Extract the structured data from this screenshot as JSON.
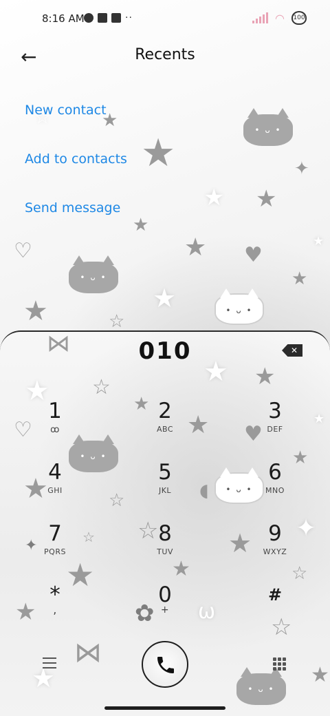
{
  "status_bar": {
    "time": "8:16 AM",
    "battery": "100",
    "icons": [
      "signal-icon",
      "wifi-icon",
      "battery-icon"
    ]
  },
  "header": {
    "title": "Recents",
    "back_icon": "back-arrow-icon"
  },
  "actions": [
    {
      "label": "New contact"
    },
    {
      "label": "Add to contacts"
    },
    {
      "label": "Send message"
    }
  ],
  "dialer": {
    "number": "010",
    "backspace_icon": "backspace-icon",
    "keys": [
      {
        "digit": "1",
        "letters": "ꝏ"
      },
      {
        "digit": "2",
        "letters": "ABC"
      },
      {
        "digit": "3",
        "letters": "DEF"
      },
      {
        "digit": "4",
        "letters": "GHI"
      },
      {
        "digit": "5",
        "letters": "JKL"
      },
      {
        "digit": "6",
        "letters": "MNO"
      },
      {
        "digit": "7",
        "letters": "PQRS"
      },
      {
        "digit": "8",
        "letters": "TUV"
      },
      {
        "digit": "9",
        "letters": "WXYZ"
      },
      {
        "digit": "*",
        "letters": ","
      },
      {
        "digit": "0",
        "letters": "+"
      },
      {
        "digit": "#",
        "letters": ""
      }
    ]
  },
  "bottom_bar": {
    "menu_icon": "menu-icon",
    "call_icon": "phone-icon",
    "keypad_icon": "keypad-icon"
  },
  "colors": {
    "accent": "#1e88e5",
    "text": "#111111",
    "status_pink": "#e9a3b5"
  }
}
